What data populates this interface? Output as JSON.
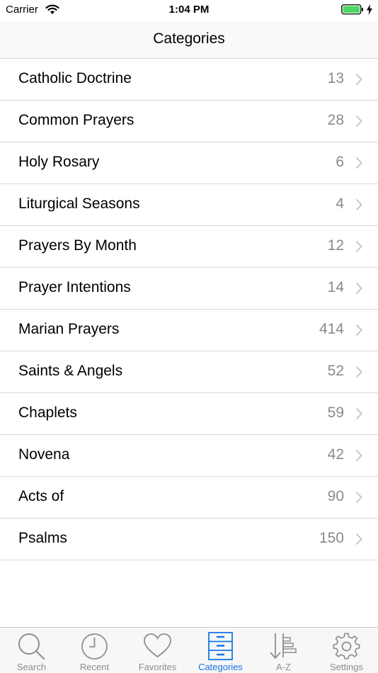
{
  "status_bar": {
    "carrier": "Carrier",
    "time": "1:04 PM"
  },
  "nav": {
    "title": "Categories"
  },
  "categories": [
    {
      "label": "Catholic Doctrine",
      "count": "13"
    },
    {
      "label": "Common Prayers",
      "count": "28"
    },
    {
      "label": "Holy Rosary",
      "count": "6"
    },
    {
      "label": "Liturgical Seasons",
      "count": "4"
    },
    {
      "label": "Prayers By Month",
      "count": "12"
    },
    {
      "label": "Prayer Intentions",
      "count": "14"
    },
    {
      "label": "Marian Prayers",
      "count": "414"
    },
    {
      "label": "Saints & Angels",
      "count": "52"
    },
    {
      "label": "Chaplets",
      "count": "59"
    },
    {
      "label": "Novena",
      "count": "42"
    },
    {
      "label": "Acts of",
      "count": "90"
    },
    {
      "label": "Psalms",
      "count": "150"
    }
  ],
  "tabs": [
    {
      "label": "Search",
      "icon": "search-icon"
    },
    {
      "label": "Recent",
      "icon": "clock-icon"
    },
    {
      "label": "Favorites",
      "icon": "heart-icon"
    },
    {
      "label": "Categories",
      "icon": "cabinet-icon",
      "active": true
    },
    {
      "label": "A-Z",
      "icon": "sort-icon"
    },
    {
      "label": "Settings",
      "icon": "gear-icon"
    }
  ],
  "colors": {
    "accent": "#1476e8",
    "inactive": "#8e8e93",
    "battery": "#4cd964"
  }
}
